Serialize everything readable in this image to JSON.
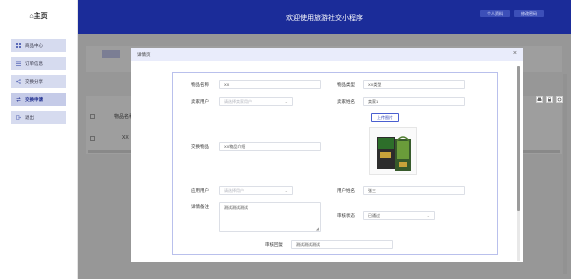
{
  "sidebar": {
    "logo": "⌂主页",
    "items": [
      {
        "label": "商品中心",
        "icon": "grid-icon"
      },
      {
        "label": "订单信息",
        "icon": "list-icon"
      },
      {
        "label": "交换分享",
        "icon": "share-icon"
      },
      {
        "label": "交换申请",
        "icon": "exchange-icon",
        "active": true
      },
      {
        "label": "退出",
        "icon": "logout-icon"
      }
    ]
  },
  "header": {
    "title": "欢迎使用旅游社交小程序",
    "buttons": [
      "个人资料",
      "修改密码"
    ]
  },
  "page": {
    "columns": [
      "物品名称"
    ],
    "rows": [
      [
        "XX"
      ]
    ]
  },
  "dialog": {
    "title": "详情页",
    "close": "×",
    "fields": {
      "item_name": {
        "label": "物品名称",
        "value": "XX"
      },
      "item_type": {
        "label": "物品类型",
        "value": "XX类型"
      },
      "seller_account": {
        "label": "卖家用户",
        "placeholder": "请选择卖家用户"
      },
      "seller_name": {
        "label": "卖家姓名",
        "value": "卖家1"
      },
      "upload": {
        "label": "上传图片"
      },
      "exchange_item": {
        "label": "交换物品",
        "value": "XX物品介绍"
      },
      "apply_account": {
        "label": "应用用户",
        "placeholder": "请选择用户"
      },
      "user_name": {
        "label": "用户姓名",
        "value": "张三"
      },
      "detail_note": {
        "label": "详情备注",
        "value": "测试测试测试"
      },
      "audit_status": {
        "label": "审核状态",
        "value": "已通过"
      },
      "audit_reply": {
        "label": "审核回复",
        "value": "测试测试测试"
      }
    }
  },
  "colors": {
    "header_bg": "#1b2c99",
    "sidebar_item_bg": "#d6dbef",
    "dialog_head_bg": "#e9ecfb",
    "form_border": "#b9c0ec"
  }
}
